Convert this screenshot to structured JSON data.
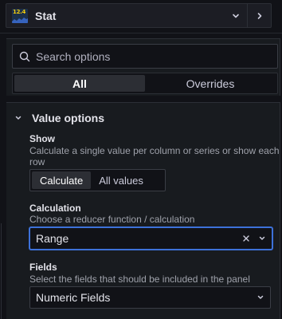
{
  "viz_picker": {
    "icon_text": "12.4",
    "name": "Stat"
  },
  "search": {
    "placeholder": "Search options"
  },
  "tabs": [
    {
      "label": "All",
      "active": true
    },
    {
      "label": "Overrides",
      "active": false
    }
  ],
  "section": {
    "title": "Value options",
    "expanded": true
  },
  "show": {
    "label": "Show",
    "description_line1": "Calculate a single value per column or series or show each",
    "description_line2": "row",
    "options": [
      {
        "label": "Calculate",
        "active": true
      },
      {
        "label": "All values",
        "active": false
      }
    ]
  },
  "calculation": {
    "label": "Calculation",
    "description": "Choose a reducer function / calculation",
    "value": "Range"
  },
  "fields": {
    "label": "Fields",
    "description": "Select the fields that should be included in the panel",
    "value": "Numeric Fields"
  },
  "colors": {
    "background": "#111217",
    "panel": "#181b1f",
    "focus_border": "#3d71d9",
    "icon_number": "#f2cc0c"
  },
  "icons": [
    "stat-viz-icon",
    "chevron-down-icon",
    "chevron-right-icon",
    "search-icon",
    "clear-icon"
  ]
}
